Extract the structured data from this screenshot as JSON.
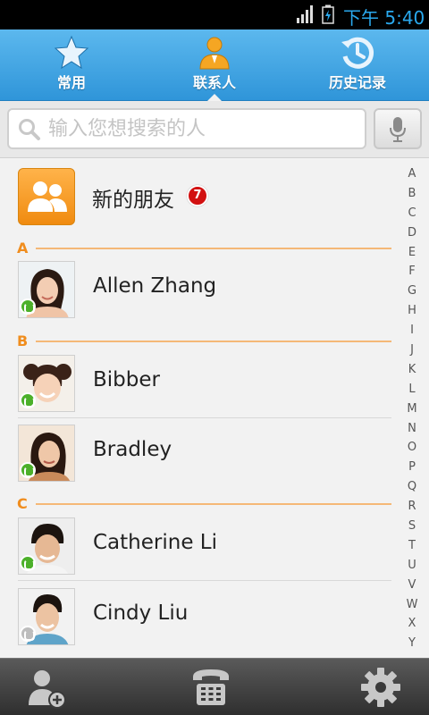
{
  "status_bar": {
    "time": "下午 5:40",
    "icons": [
      "signal-icon",
      "battery-charging-icon"
    ]
  },
  "tabs": [
    {
      "label": "常用",
      "icon": "star-icon",
      "active": false
    },
    {
      "label": "联系人",
      "icon": "person-icon",
      "active": true
    },
    {
      "label": "历史记录",
      "icon": "history-clock-icon",
      "active": false
    }
  ],
  "search": {
    "placeholder": "输入您想搜索的人",
    "value": "",
    "icon": "search-icon",
    "voice_icon": "microphone-icon"
  },
  "new_friends": {
    "label": "新的朋友",
    "badge": "7",
    "icon": "group-people-icon"
  },
  "sections": [
    {
      "letter": "A",
      "contacts": [
        {
          "name": "Allen Zhang",
          "online": true
        }
      ]
    },
    {
      "letter": "B",
      "contacts": [
        {
          "name": "Bibber",
          "online": true
        },
        {
          "name": "Bradley",
          "online": true
        }
      ]
    },
    {
      "letter": "C",
      "contacts": [
        {
          "name": "Catherine Li",
          "online": true
        },
        {
          "name": "Cindy Liu",
          "online": false
        }
      ]
    }
  ],
  "alphabet": [
    "A",
    "B",
    "C",
    "D",
    "E",
    "F",
    "G",
    "H",
    "I",
    "J",
    "K",
    "L",
    "M",
    "N",
    "O",
    "P",
    "Q",
    "R",
    "S",
    "T",
    "U",
    "V",
    "W",
    "X",
    "Y"
  ],
  "bottom_bar": {
    "buttons": [
      "add-contact-icon",
      "phone-dialpad-icon",
      "settings-gear-icon"
    ]
  },
  "colors": {
    "tab_bar": "#3ea3e3",
    "accent_orange": "#f08d1e",
    "badge_red": "#d21010",
    "online_green": "#4cb02a"
  }
}
